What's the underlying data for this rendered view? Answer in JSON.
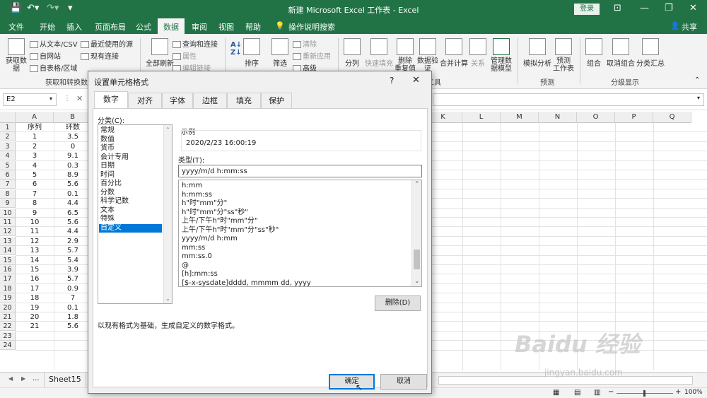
{
  "window": {
    "title": "新建 Microsoft Excel 工作表  -  Excel",
    "login": "登录"
  },
  "ribbon_tabs": [
    "文件",
    "开始",
    "插入",
    "页面布局",
    "公式",
    "数据",
    "审阅",
    "视图",
    "帮助"
  ],
  "tellme": "操作说明搜索",
  "share": "共享",
  "ribbon": {
    "get_data": "获取数\n据",
    "from_text": "从文本/CSV",
    "from_web": "自网站",
    "from_table": "自表格/区域",
    "recent": "最近使用的源",
    "existing": "现有连接",
    "group_get": "获取和转换数据",
    "refresh_all": "全部刷新",
    "queries": "查询和连接",
    "properties": "属性",
    "edit_links": "编辑链接",
    "sort": "排序",
    "filter": "筛选",
    "clear": "清除",
    "reapply": "重新应用",
    "advanced": "高级",
    "split": "分列",
    "flash_fill": "快速填充",
    "remove_dup": "删除\n重复值",
    "validation": "数据验\n证",
    "consolidate": "合并计算",
    "relations": "关系",
    "data_model": "管理数\n据模型",
    "tools_suffix": "工具",
    "whatif": "模拟分析",
    "forecast": "预测\n工作表",
    "group_forecast": "预测",
    "group": "组合",
    "ungroup": "取消组合",
    "subtotal": "分类汇总",
    "group_outline": "分级显示"
  },
  "namebox": "E2",
  "columns": [
    "A",
    "B",
    "C",
    "D",
    "E",
    "F",
    "G",
    "H",
    "I",
    "J",
    "K",
    "L",
    "M",
    "N",
    "O",
    "P",
    "Q"
  ],
  "rows": [
    [
      "序列",
      "环数"
    ],
    [
      "1",
      "3.5"
    ],
    [
      "2",
      "0"
    ],
    [
      "3",
      "9.1"
    ],
    [
      "4",
      "0.3"
    ],
    [
      "5",
      "8.9"
    ],
    [
      "6",
      "5.6"
    ],
    [
      "7",
      "0.1"
    ],
    [
      "8",
      "4.4"
    ],
    [
      "9",
      "6.5"
    ],
    [
      "10",
      "5.6"
    ],
    [
      "11",
      "4.4"
    ],
    [
      "12",
      "2.9"
    ],
    [
      "13",
      "5.7"
    ],
    [
      "14",
      "5.4"
    ],
    [
      "15",
      "3.9"
    ],
    [
      "16",
      "5.7"
    ],
    [
      "17",
      "0.9"
    ],
    [
      "18",
      "7"
    ],
    [
      "19",
      "0.1"
    ],
    [
      "20",
      "1.8"
    ],
    [
      "21",
      "5.6"
    ],
    [
      "",
      ""
    ],
    [
      "",
      ""
    ]
  ],
  "sheet": "Sheet15",
  "sheet_nav": [
    "◀",
    "▶",
    "..."
  ],
  "zoom": "100%",
  "dialog": {
    "title": "设置单元格格式",
    "help": "?",
    "tabs": [
      "数字",
      "对齐",
      "字体",
      "边框",
      "填充",
      "保护"
    ],
    "category_label": "分类(C):",
    "categories": [
      "常规",
      "数值",
      "货币",
      "会计专用",
      "日期",
      "时间",
      "百分比",
      "分数",
      "科学记数",
      "文本",
      "特殊",
      "自定义"
    ],
    "selected_category": "自定义",
    "sample_label": "示例",
    "sample_value": "2020/2/23 16:00:19",
    "type_label": "类型(T):",
    "type_value": "yyyy/m/d h:mm:ss",
    "formats": [
      "h:mm",
      "h:mm:ss",
      "h\"时\"mm\"分\"",
      "h\"时\"mm\"分\"ss\"秒\"",
      "上午/下午h\"时\"mm\"分\"",
      "上午/下午h\"时\"mm\"分\"ss\"秒\"",
      "yyyy/m/d h:mm",
      "mm:ss",
      "mm:ss.0",
      "@",
      "[h]:mm:ss",
      "[$-x-sysdate]dddd, mmmm dd, yyyy"
    ],
    "delete": "删除(D)",
    "desc": "以现有格式为基础，生成自定义的数字格式。",
    "ok": "确定",
    "cancel": "取消"
  },
  "watermark": "jingyan.baidu.com",
  "colors": {
    "excel_green": "#217346",
    "select_blue": "#0078d7"
  }
}
